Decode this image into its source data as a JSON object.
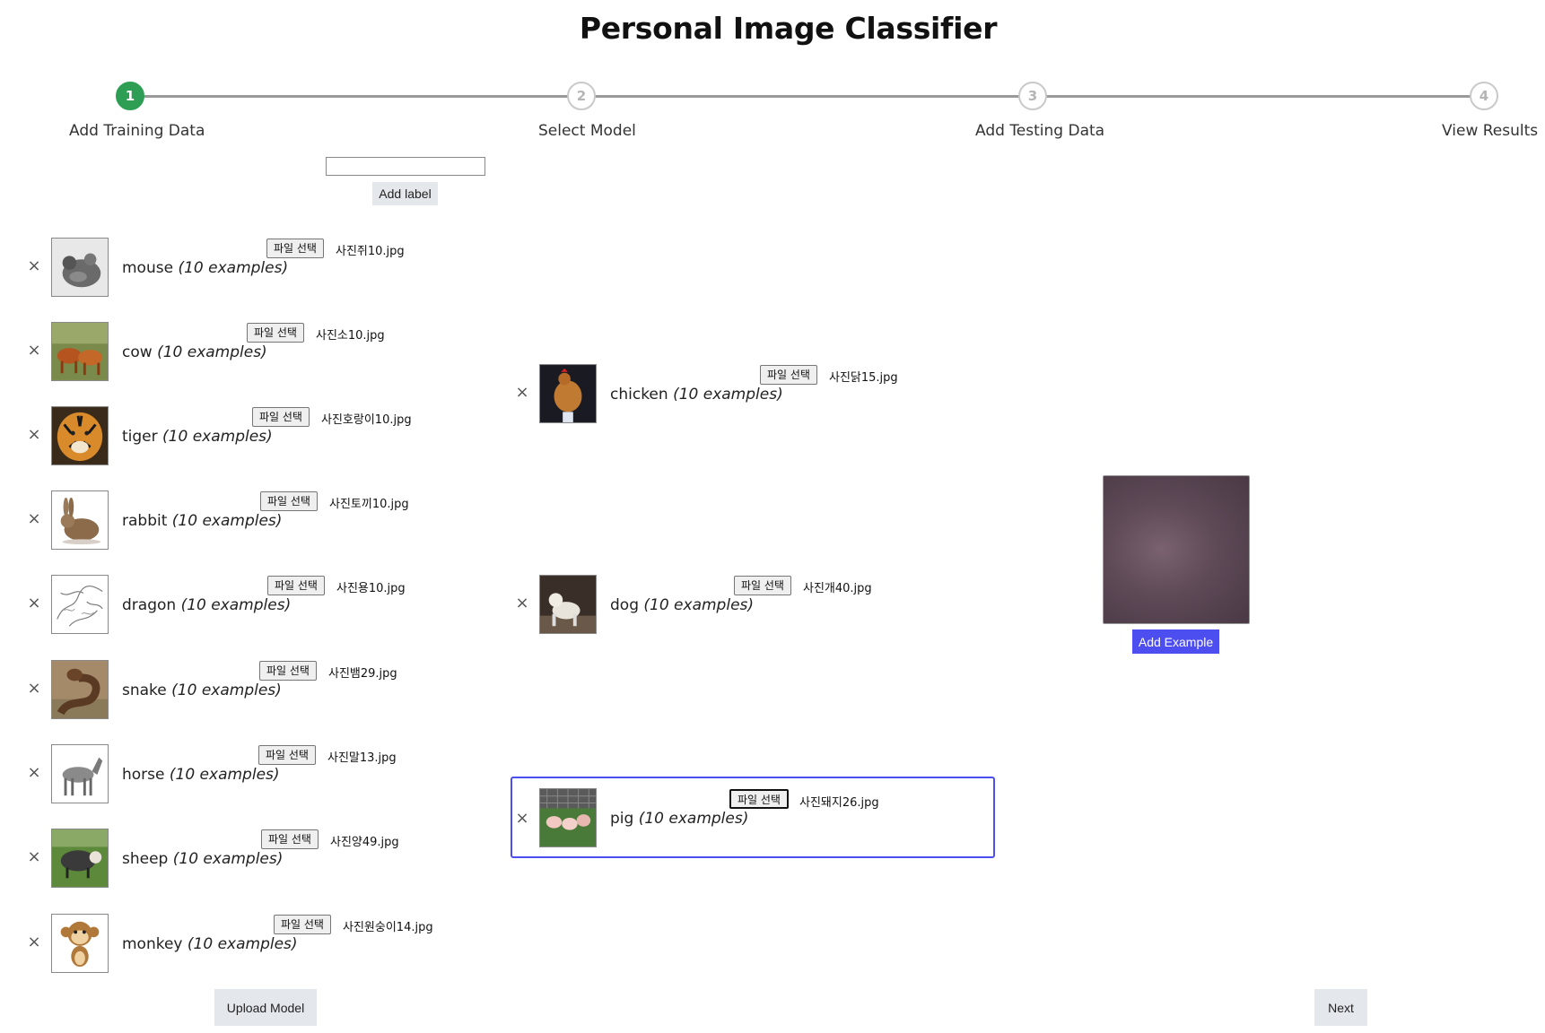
{
  "title": "Personal Image Classifier",
  "steps": [
    {
      "num": "1",
      "label": "Add Training Data"
    },
    {
      "num": "2",
      "label": "Select Model"
    },
    {
      "num": "3",
      "label": "Add Testing Data"
    },
    {
      "num": "4",
      "label": "View Results"
    }
  ],
  "add_label_button": "Add label",
  "label_input_value": "",
  "close_glyph": "×",
  "classes_left": [
    {
      "name": "mouse",
      "count": "(10 examples)",
      "file_button": "파일 선택",
      "file_name": "사진쥐10.jpg"
    },
    {
      "name": "cow",
      "count": "(10 examples)",
      "file_button": "파일 선택",
      "file_name": "사진소10.jpg"
    },
    {
      "name": "tiger",
      "count": "(10 examples)",
      "file_button": "파일 선택",
      "file_name": "사진호랑이10.jpg"
    },
    {
      "name": "rabbit",
      "count": "(10 examples)",
      "file_button": "파일 선택",
      "file_name": "사진토끼10.jpg"
    },
    {
      "name": "dragon",
      "count": "(10 examples)",
      "file_button": "파일 선택",
      "file_name": "사진용10.jpg"
    },
    {
      "name": "snake",
      "count": "(10 examples)",
      "file_button": "파일 선택",
      "file_name": "사진뱀29.jpg"
    },
    {
      "name": "horse",
      "count": "(10 examples)",
      "file_button": "파일 선택",
      "file_name": "사진말13.jpg"
    },
    {
      "name": "sheep",
      "count": "(10 examples)",
      "file_button": "파일 선택",
      "file_name": "사진양49.jpg"
    },
    {
      "name": "monkey",
      "count": "(10 examples)",
      "file_button": "파일 선택",
      "file_name": "사진원숭이14.jpg"
    }
  ],
  "classes_right": [
    {
      "name": "chicken",
      "count": "(10 examples)",
      "file_button": "파일 선택",
      "file_name": "사진닭15.jpg"
    },
    {
      "name": "dog",
      "count": "(10 examples)",
      "file_button": "파일 선택",
      "file_name": "사진개40.jpg"
    },
    {
      "name": "pig",
      "count": "(10 examples)",
      "file_button": "파일 선택",
      "file_name": "사진돼지26.jpg"
    }
  ],
  "add_example_button": "Add Example",
  "upload_model_button": "Upload Model",
  "next_button": "Next",
  "colors": {
    "accent": "#4d4ef0",
    "step_active": "#2e9e55"
  }
}
